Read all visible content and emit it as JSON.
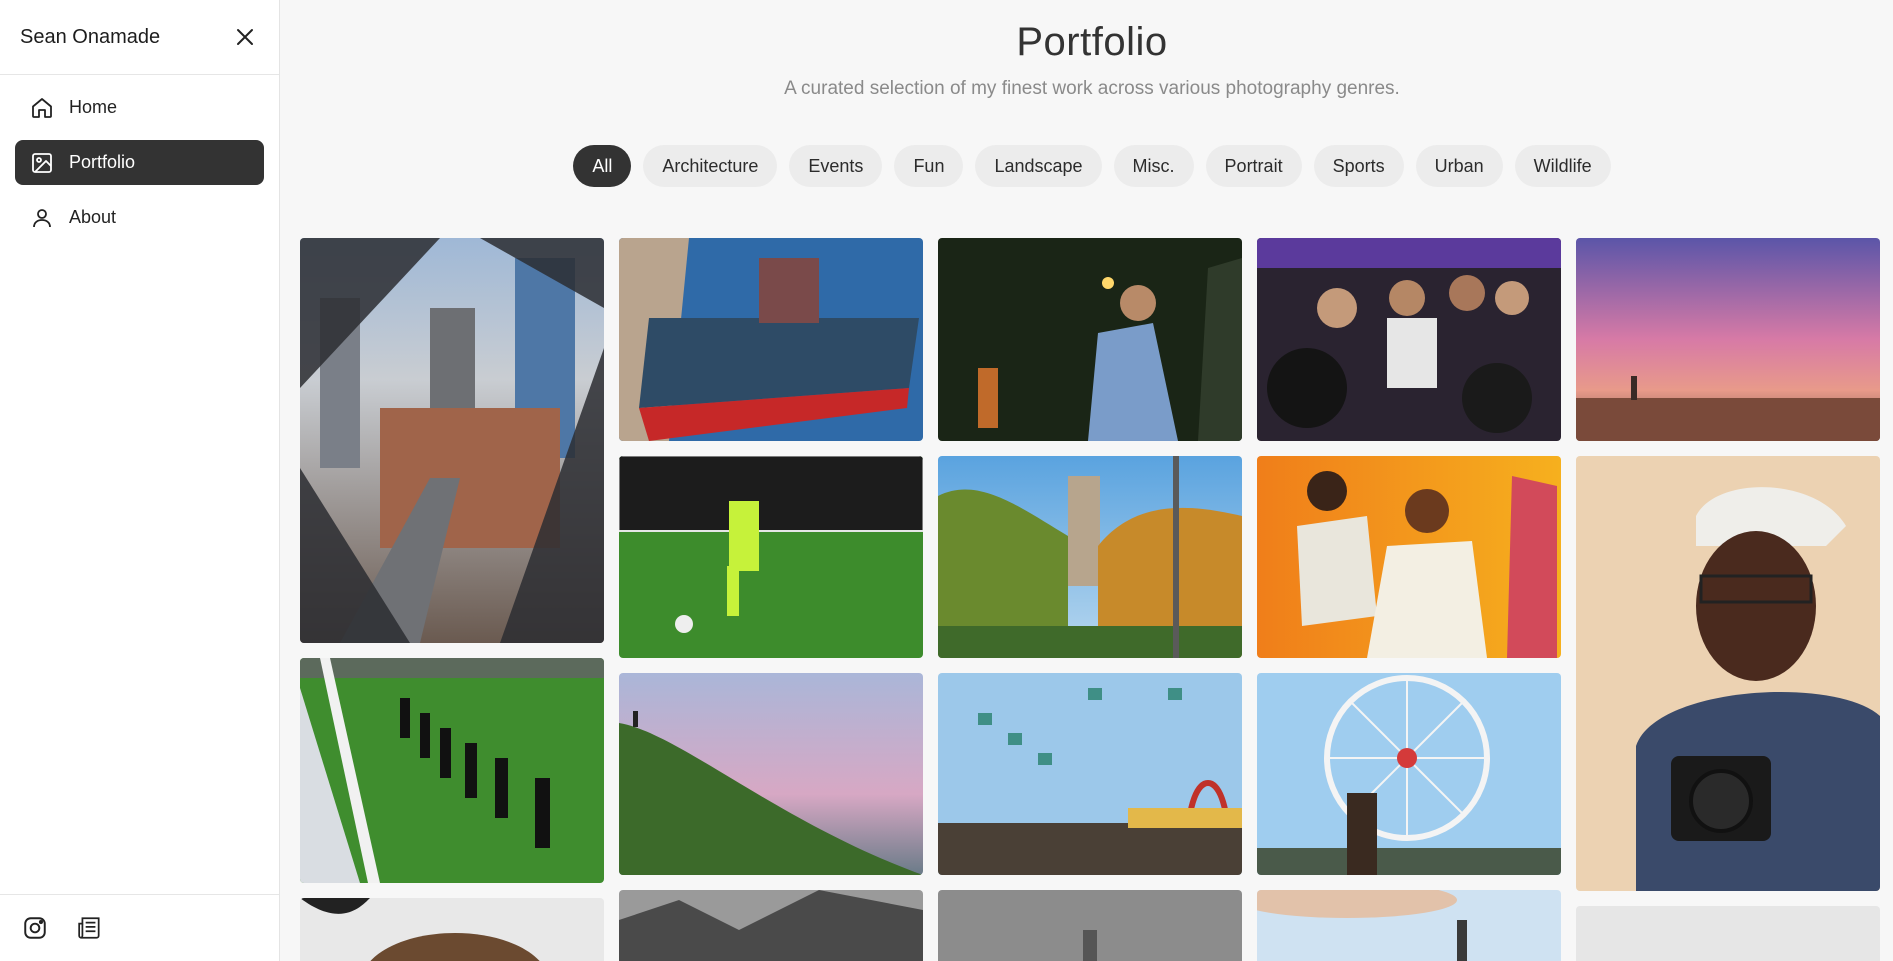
{
  "sidebar": {
    "brand": "Sean Onamade",
    "nav": [
      {
        "label": "Home",
        "icon": "home-icon"
      },
      {
        "label": "Portfolio",
        "icon": "image-icon",
        "active": true
      },
      {
        "label": "About",
        "icon": "user-icon"
      }
    ],
    "footer_icons": [
      "instagram-icon",
      "newspaper-icon"
    ]
  },
  "header": {
    "title": "Portfolio",
    "subtitle": "A curated selection of my finest work across various photography genres."
  },
  "filters": {
    "selected": "All",
    "options": [
      "All",
      "Architecture",
      "Events",
      "Fun",
      "Landscape",
      "Misc.",
      "Portrait",
      "Sports",
      "Urban",
      "Wildlife"
    ]
  },
  "colors": {
    "accent_dark": "#333333",
    "chip_bg": "#ececec",
    "page_bg": "#f7f7f7"
  }
}
